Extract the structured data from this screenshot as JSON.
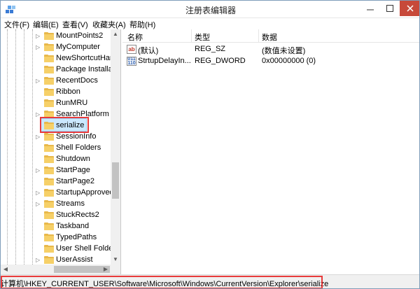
{
  "window": {
    "title": "注册表编辑器",
    "accent_close": "#c7493a",
    "highlight_border": "#e83b3b"
  },
  "menu": {
    "items": [
      "文件(F)",
      "编辑(E)",
      "查看(V)",
      "收藏夹(A)",
      "帮助(H)"
    ]
  },
  "tree": {
    "items": [
      {
        "label": "MountPoints2",
        "expandable": true
      },
      {
        "label": "MyComputer",
        "expandable": true
      },
      {
        "label": "NewShortcutHan",
        "expandable": false
      },
      {
        "label": "Package Installat",
        "expandable": false
      },
      {
        "label": "RecentDocs",
        "expandable": true
      },
      {
        "label": "Ribbon",
        "expandable": false
      },
      {
        "label": "RunMRU",
        "expandable": false
      },
      {
        "label": "SearchPlatform",
        "expandable": true
      },
      {
        "label": "serialize",
        "expandable": false,
        "selected": true
      },
      {
        "label": "SessionInfo",
        "expandable": true
      },
      {
        "label": "Shell Folders",
        "expandable": false
      },
      {
        "label": "Shutdown",
        "expandable": false
      },
      {
        "label": "StartPage",
        "expandable": true
      },
      {
        "label": "StartPage2",
        "expandable": false
      },
      {
        "label": "StartupApproved",
        "expandable": true
      },
      {
        "label": "Streams",
        "expandable": true
      },
      {
        "label": "StuckRects2",
        "expandable": false
      },
      {
        "label": "Taskband",
        "expandable": false
      },
      {
        "label": "TypedPaths",
        "expandable": false
      },
      {
        "label": "User Shell Folder",
        "expandable": false
      },
      {
        "label": "UserAssist",
        "expandable": true
      }
    ]
  },
  "values": {
    "headers": {
      "name": "名称",
      "type": "类型",
      "data": "数据"
    },
    "rows": [
      {
        "icon": "string-value-icon",
        "icon_text": "ab",
        "name": "(默认)",
        "type": "REG_SZ",
        "data": "(数值未设置)"
      },
      {
        "icon": "binary-value-icon",
        "icon_text": "011\n110",
        "name": "StrtupDelayIn...",
        "type": "REG_DWORD",
        "data": "0x00000000 (0)"
      }
    ]
  },
  "status": {
    "path": "计算机\\HKEY_CURRENT_USER\\Software\\Microsoft\\Windows\\CurrentVersion\\Explorer\\serialize"
  }
}
